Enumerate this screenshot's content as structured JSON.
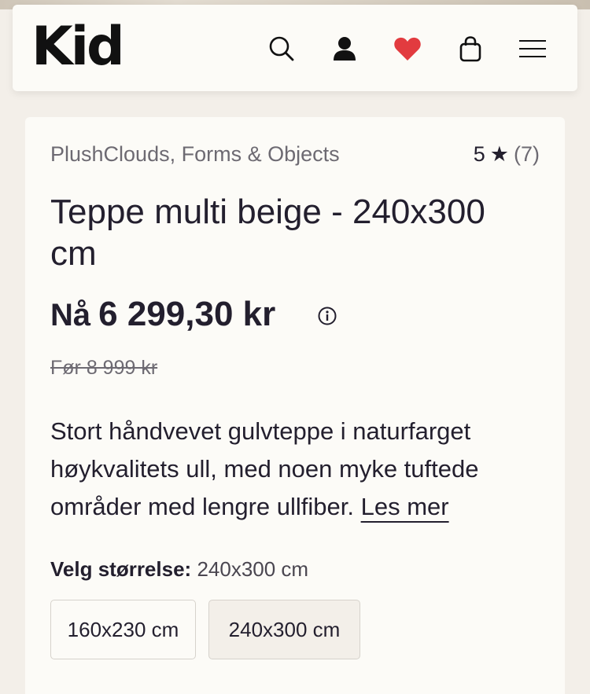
{
  "header": {
    "logo": "Kid",
    "icons": [
      "search-icon",
      "account-icon",
      "heart-icon",
      "bag-icon",
      "menu-icon"
    ],
    "heart_color": "#e23b3f"
  },
  "product": {
    "brand": "PlushClouds, Forms & Objects",
    "rating_value": "5",
    "rating_star": "★",
    "rating_count": "(7)",
    "title": "Teppe multi beige - 240x300 cm",
    "price_prefix": "Nå",
    "price": "6 299,30 kr",
    "before_price": "Før 8 999 kr",
    "description": "Stort håndvevet gulvteppe i naturfarget høykvalitets ull, med noen myke tuftede områder med lengre ullfiber.",
    "read_more": "Les mer",
    "size_label": "Velg størrelse:",
    "size_selected": "240x300 cm",
    "sizes": [
      "160x230 cm",
      "240x300 cm"
    ]
  }
}
